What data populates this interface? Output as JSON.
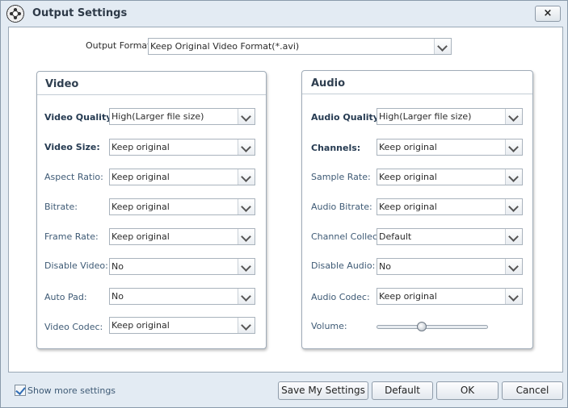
{
  "window": {
    "title": "Output Settings",
    "close_label": "×"
  },
  "output_format": {
    "label": "Output Format:",
    "value": "Keep Original Video Format(*.avi)"
  },
  "video": {
    "title": "Video",
    "rows": [
      {
        "label": "Video Quality:",
        "value": "High(Larger file size)"
      },
      {
        "label": "Video Size:",
        "value": "Keep original"
      },
      {
        "label": "Aspect Ratio:",
        "value": "Keep original"
      },
      {
        "label": "Bitrate:",
        "value": "Keep original"
      },
      {
        "label": "Frame Rate:",
        "value": "Keep original"
      },
      {
        "label": "Disable Video:",
        "value": "No"
      },
      {
        "label": "Auto Pad:",
        "value": "No"
      },
      {
        "label": "Video Codec:",
        "value": "Keep original"
      }
    ]
  },
  "audio": {
    "title": "Audio",
    "rows": [
      {
        "label": "Audio Quality:",
        "value": "High(Larger file size)"
      },
      {
        "label": "Channels:",
        "value": "Keep original"
      },
      {
        "label": "Sample Rate:",
        "value": "Keep original"
      },
      {
        "label": "Audio Bitrate:",
        "value": "Keep original"
      },
      {
        "label": "Channel Collect:",
        "value": "Default"
      },
      {
        "label": "Disable Audio:",
        "value": "No"
      },
      {
        "label": "Audio Codec:",
        "value": "Keep original"
      }
    ],
    "volume": {
      "label": "Volume:",
      "level": 0.4
    }
  },
  "footer": {
    "show_more_label": "Show more settings",
    "show_more_checked": true,
    "save_label": "Save My Settings",
    "default_label": "Default",
    "ok_label": "OK",
    "cancel_label": "Cancel"
  }
}
